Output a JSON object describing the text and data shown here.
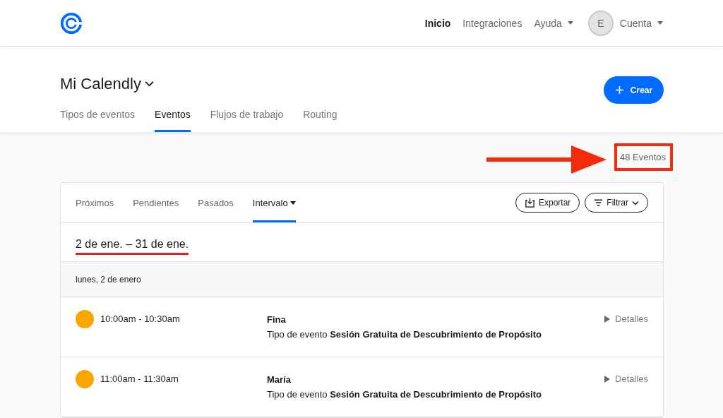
{
  "nav": {
    "items": [
      {
        "label": "Inicio",
        "selected": true,
        "dropdown": false
      },
      {
        "label": "Integraciones",
        "selected": false,
        "dropdown": false
      },
      {
        "label": "Ayuda",
        "selected": false,
        "dropdown": true
      }
    ],
    "avatar": "E",
    "account": "Cuenta"
  },
  "page": {
    "title": "Mi Calendly",
    "create": "Crear"
  },
  "tabs": [
    {
      "label": "Tipos de eventos",
      "selected": false
    },
    {
      "label": "Eventos",
      "selected": true
    },
    {
      "label": "Flujos de trabajo",
      "selected": false
    },
    {
      "label": "Routing",
      "selected": false
    }
  ],
  "count": "48 Eventos",
  "subtabs": [
    {
      "label": "Próximos",
      "selected": false,
      "dropdown": false
    },
    {
      "label": "Pendientes",
      "selected": false,
      "dropdown": false
    },
    {
      "label": "Pasados",
      "selected": false,
      "dropdown": false
    },
    {
      "label": "Intervalo",
      "selected": true,
      "dropdown": true
    }
  ],
  "actions": {
    "export": "Exportar",
    "filter": "Filtrar"
  },
  "range": "2 de ene. – 31 de ene.",
  "day": "lunes, 2 de enero",
  "events": [
    {
      "color": "#f8a700",
      "time": "10:00am - 10:30am",
      "name": "Fina",
      "type": "Tipo de evento **Sesión Gratuita de Descubrimiento de Propósito**",
      "details": "Detalles"
    },
    {
      "color": "#f8a700",
      "time": "11:00am - 11:30am",
      "name": "María",
      "type": "Tipo de evento **Sesión Gratuita de Descubrimiento de Propósito**",
      "details": "Detalles"
    }
  ]
}
